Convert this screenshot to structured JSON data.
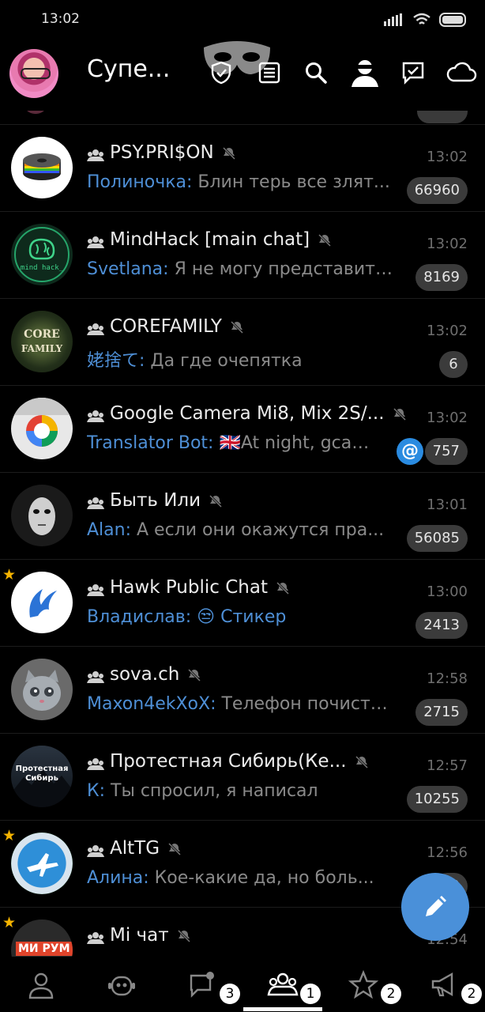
{
  "status_bar": {
    "time": "13:02"
  },
  "header": {
    "title": "Супе...",
    "icons": [
      "mask-icon",
      "shield-check-icon",
      "list-icon",
      "search-icon",
      "incognito-icon",
      "message-check-icon",
      "cloud-icon"
    ]
  },
  "chats": [
    {
      "title": "PSY.PRI$ON",
      "time": "13:02",
      "sender": "Полиночка:",
      "preview": " Блин терь все злят...",
      "badge": "66960",
      "muted": true,
      "starred": false,
      "avatar": "rainbow-disc"
    },
    {
      "title": "MindHack [main chat]",
      "time": "13:02",
      "sender": "Svetlana:",
      "preview": " Я не могу представить...",
      "badge": "8169",
      "muted": true,
      "starred": false,
      "avatar": "brain-logo"
    },
    {
      "title": "COREFAMILY",
      "time": "13:02",
      "sender": "姥捨て:",
      "preview": " Да где очепятка",
      "badge": "6",
      "muted": true,
      "starred": false,
      "avatar": "forest"
    },
    {
      "title": "Google Camera Mi8, Mix 2S/...",
      "time": "13:02",
      "sender": "Translator Bot:",
      "preview": " 🇬🇧At night, gcam...",
      "badge": "757",
      "mention": "@",
      "muted": true,
      "starred": false,
      "avatar": "camera"
    },
    {
      "title": "Быть Или",
      "time": "13:01",
      "sender": "Alan:",
      "preview": " А если они окажутся пра...",
      "badge": "56085",
      "muted": true,
      "starred": false,
      "avatar": "mask-face"
    },
    {
      "title": "Hawk Public Chat",
      "time": "13:00",
      "sender": "Владислав:",
      "preview": " 😒 Стикер",
      "preview_highlight": true,
      "badge": "2413",
      "muted": true,
      "starred": true,
      "avatar": "hawk"
    },
    {
      "title": "sova.ch",
      "time": "12:58",
      "sender": "Maxon4ekXoX:",
      "preview": " Телефон почисти...",
      "badge": "2715",
      "muted": true,
      "starred": false,
      "avatar": "kitten"
    },
    {
      "title": "Протестная Сибирь(Ке...",
      "time": "12:57",
      "sender": "К:",
      "preview": " Ты спросил, я написал",
      "badge": "10255",
      "muted": true,
      "starred": false,
      "avatar": "siberia",
      "avatar_text": "Протестная Сибирь"
    },
    {
      "title": "AltTG",
      "time": "12:56",
      "sender": "Алина:",
      "preview": " Кое-какие да, но боль...",
      "badge": "80",
      "muted": true,
      "starred": true,
      "avatar": "plane"
    },
    {
      "title": "Mi чат",
      "time": "12:54",
      "sender": "",
      "preview": "",
      "badge": "",
      "muted": true,
      "starred": true,
      "avatar": "mi-room",
      "avatar_text": "МИ РУМ"
    }
  ],
  "bottom_nav": [
    {
      "icon": "person-icon",
      "count": ""
    },
    {
      "icon": "bot-icon",
      "count": ""
    },
    {
      "icon": "chat-bubble-icon",
      "count": "3"
    },
    {
      "icon": "group-icon",
      "count": "1",
      "active": true
    },
    {
      "icon": "star-icon",
      "count": "2"
    },
    {
      "icon": "megaphone-icon",
      "count": "2"
    }
  ],
  "colors": {
    "accent": "#4e8fd6",
    "fab": "#4a90d9",
    "star": "#f5b400",
    "badge": "#3b3b3b"
  }
}
